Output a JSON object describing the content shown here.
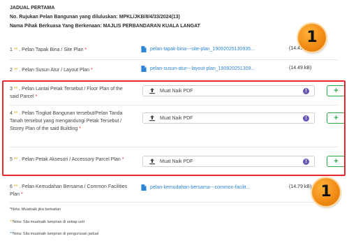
{
  "header": {
    "title": "JADUAL PERTAMA",
    "reference": "No. Rujukan Pelan Bangunan yang diluluskan: MPKL/JKB/8/4/33/2024(13)",
    "authority": "Nama Pihak Berkuasa Yang Berkenaan: MAJLIS PERBANDARAN KUALA LANGAT"
  },
  "rows": [
    {
      "num": "1",
      "stars": "**",
      "label": ". Pelan Tapak Bina / Site Plan",
      "req": "*",
      "file": "pelan-tapak-bina---site-plan_19092025130935...",
      "size": "(14.49 kB)"
    },
    {
      "num": "2",
      "stars": "**",
      "label": ". Pelan Susun Atur / Layout Plan",
      "req": "*",
      "file": "pelan-susun-atur---layout-plan_190920251309...",
      "size": "(14.49 kB)"
    },
    {
      "num": "3",
      "stars": "**",
      "label": ". Pelan Lantai Petak Tersebut / Floor Plan of the said Parcel",
      "req": "*",
      "upload": "Muat Naik PDF"
    },
    {
      "num": "4",
      "stars": "**",
      "label": ". Pelan Tingkat Bangunan tersebut/Pelan Tanda Tanah tersebut yang mengandungi Petak Tersebut / Storey Plan of the said Building",
      "req": "*",
      "upload": "Muat Naik PDF"
    },
    {
      "num": "5",
      "stars": "**",
      "label": ". Pelan Petak Aksesori / Accessory Parcel Plan",
      "req": "*",
      "upload": "Muat Naik PDF"
    },
    {
      "num": "6",
      "stars": "**",
      "label": ". Pelan Kemudahan Bersama / Common Facilities Plan",
      "req": "*",
      "file": "pelan-kemudahan-bersama---common-facilit...",
      "size": "(14.79 kB)"
    }
  ],
  "add_label": "+",
  "info_label": "!",
  "badges": [
    "1",
    "1"
  ],
  "notes": {
    "n1": "*Nota: Muatnaik jika berkaitan",
    "n2_star": "**",
    "n2": "Nota: Sila muatnaik lampiran di setiap unit",
    "n3_star": "**",
    "n3": "Nota: Sila muatnaik lampiran di pengurusan jadual"
  },
  "colors": {
    "highlight": "#e8262c",
    "badge": "#f08a14",
    "link": "#2f86d6",
    "add": "#28a745",
    "info": "#6a57b8"
  }
}
